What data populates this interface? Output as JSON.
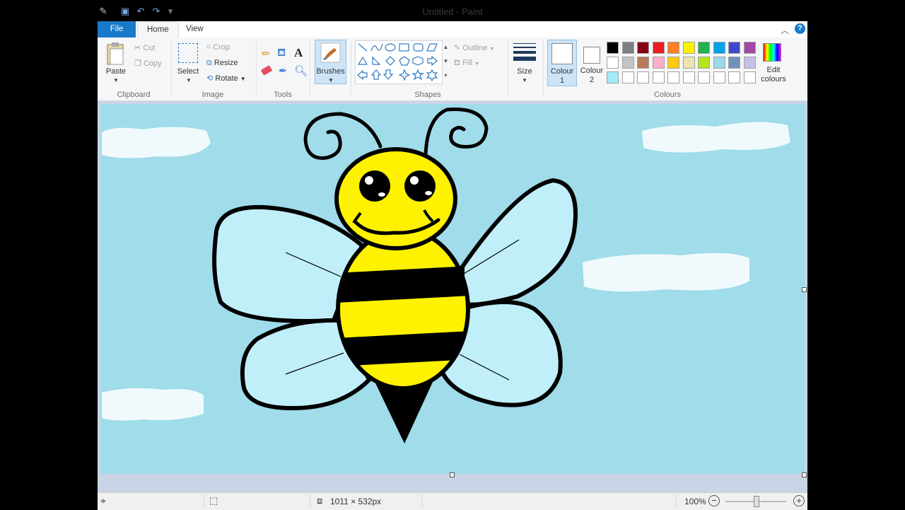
{
  "window": {
    "title": "Untitled - Paint"
  },
  "tabs": [
    {
      "label": "File"
    },
    {
      "label": "Home"
    },
    {
      "label": "View"
    }
  ],
  "clipboard": {
    "paste": "Paste",
    "cut": "Cut",
    "copy": "Copy",
    "group": "Clipboard"
  },
  "image": {
    "select": "Select",
    "crop": "Crop",
    "resize": "Resize",
    "rotate": "Rotate",
    "group": "Image"
  },
  "tools": {
    "group": "Tools"
  },
  "brushes": {
    "label": "Brushes"
  },
  "shapes": {
    "outline": "Outline",
    "fill": "Fill",
    "group": "Shapes"
  },
  "size": {
    "label": "Size"
  },
  "colours": {
    "colour1": "Colour 1",
    "colour2": "Colour 2",
    "edit": "Edit colours",
    "group": "Colours",
    "palette_row1": [
      "#000000",
      "#7f7f7f",
      "#880015",
      "#ed1c24",
      "#ff7f27",
      "#fff200",
      "#22b14c",
      "#00a2e8",
      "#3f48cc",
      "#a349a4"
    ],
    "palette_row2": [
      "#ffffff",
      "#c3c3c3",
      "#b97a57",
      "#ffaec9",
      "#ffc90e",
      "#efe4b0",
      "#b5e61d",
      "#99d9ea",
      "#7092be",
      "#c8bfe7"
    ],
    "palette_row3": [
      "#a0ecf4",
      "#ffffff",
      "#ffffff",
      "#ffffff",
      "#ffffff",
      "#ffffff",
      "#ffffff",
      "#ffffff",
      "#ffffff",
      "#ffffff"
    ]
  },
  "status": {
    "image_size": "1011 × 532px",
    "zoom": "100%"
  },
  "canvas": {
    "sky_color": "#a0dcea",
    "bee_yellow": "#fff200",
    "wing_color": "#c0effa"
  }
}
